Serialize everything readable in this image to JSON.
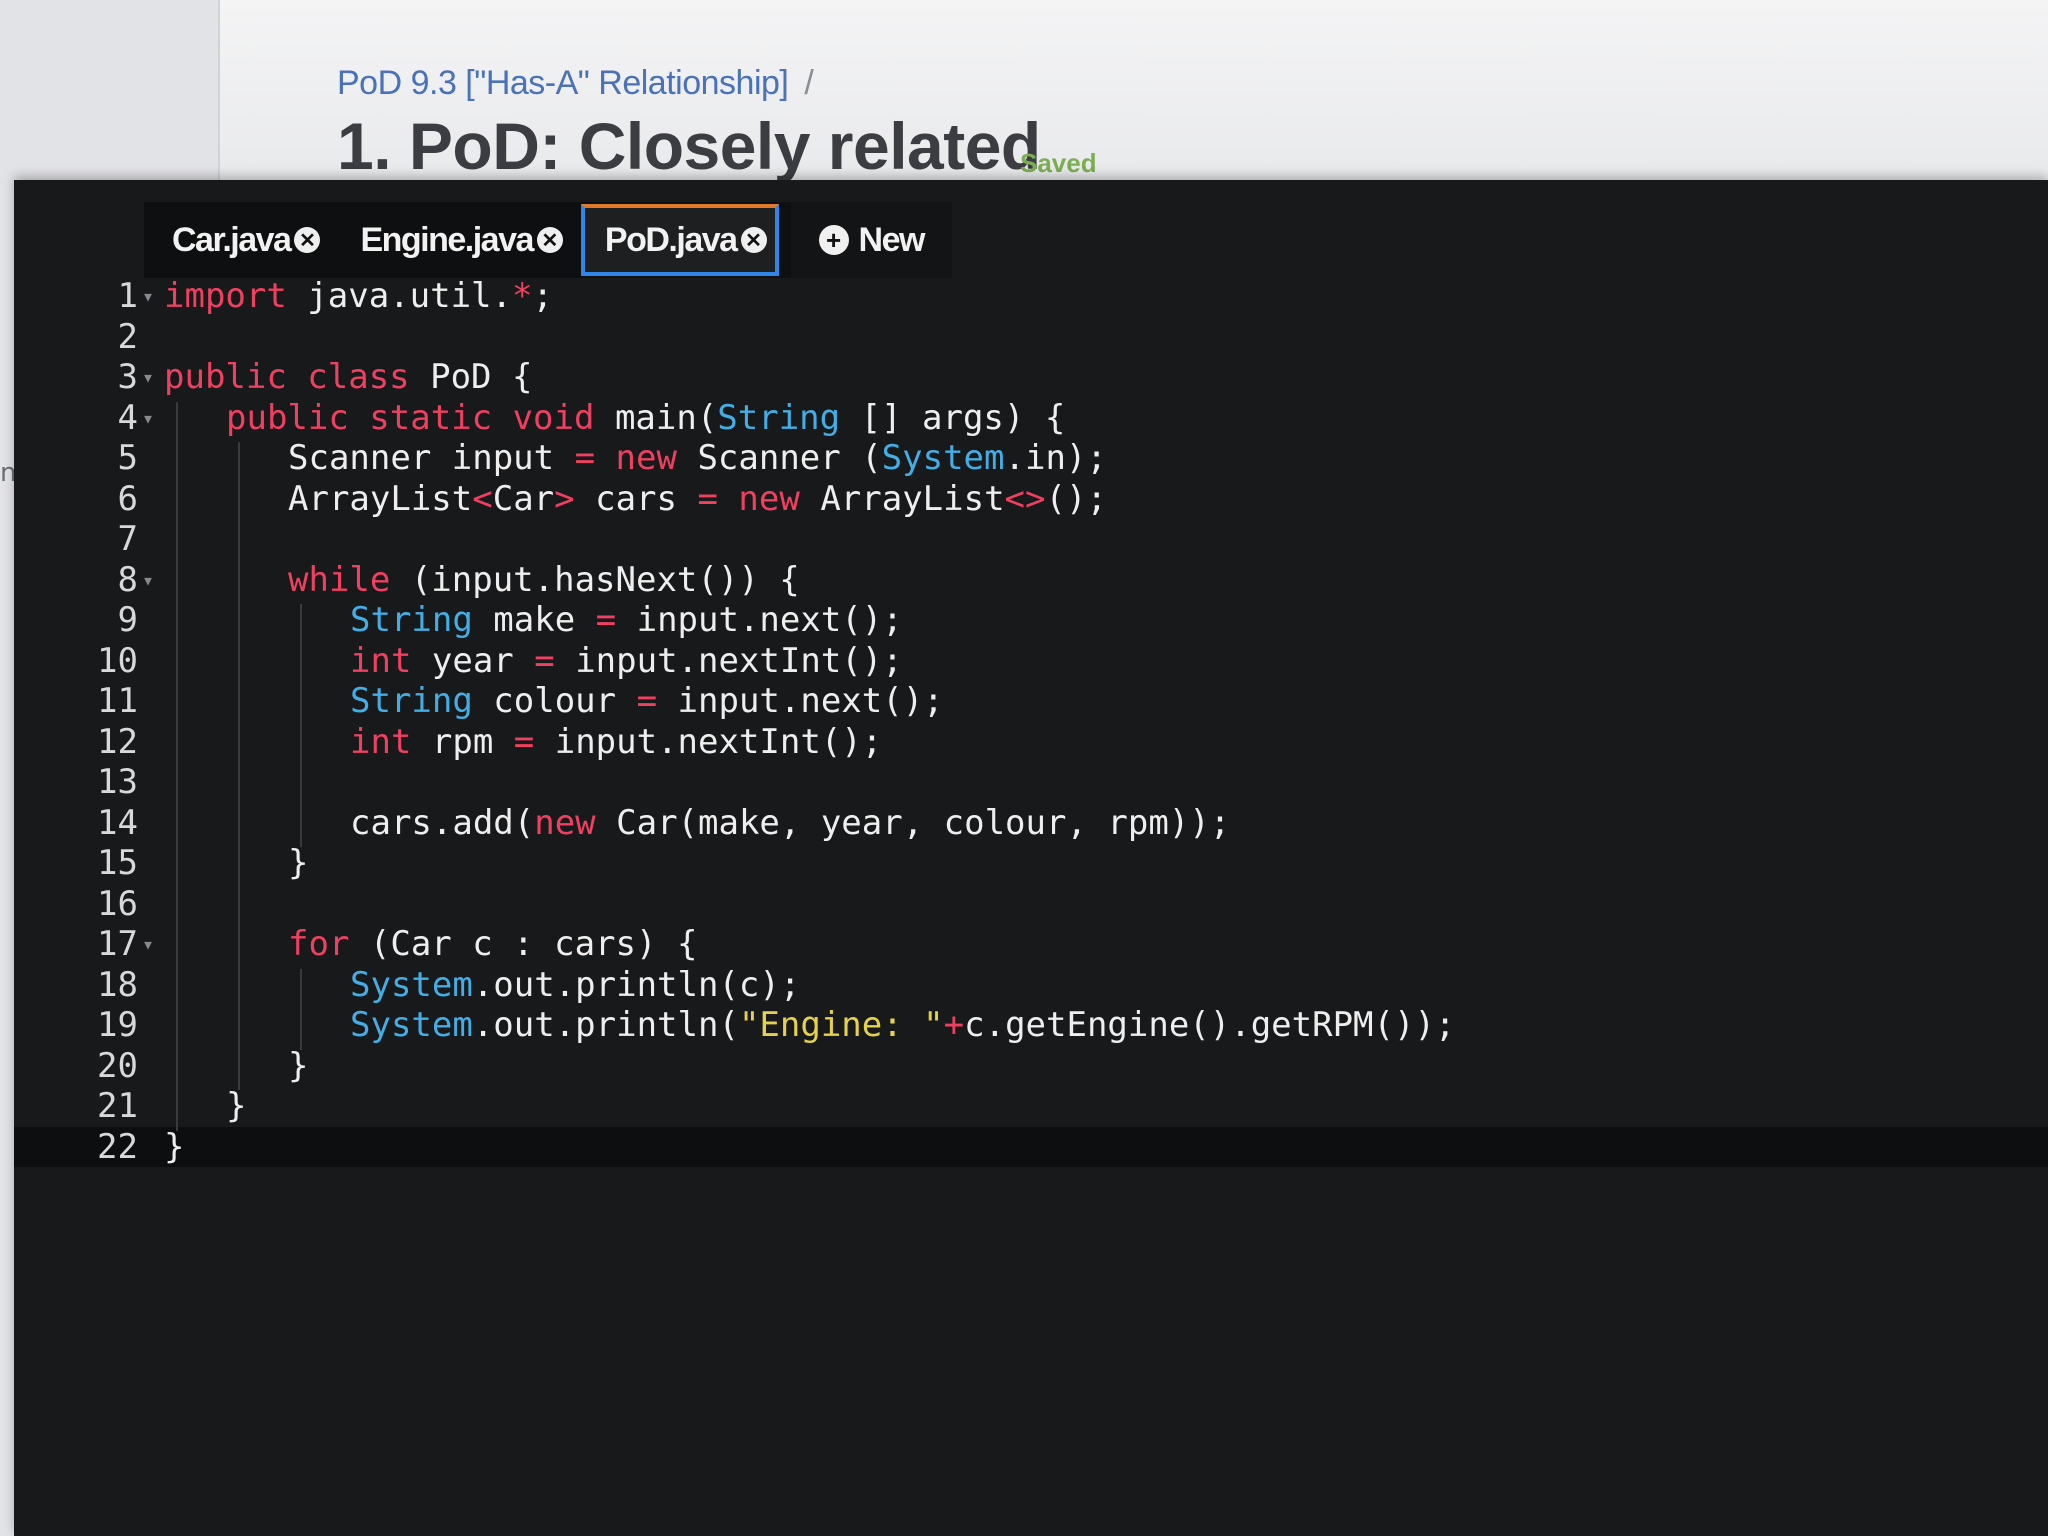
{
  "breadcrumb": {
    "course": "PoD 9.3 [\"Has-A\" Relationship]",
    "separator": "/"
  },
  "page": {
    "title": "1. PoD: Closely related",
    "status": "Saved"
  },
  "side_panel": {
    "label_fragment": "nt"
  },
  "tabs": [
    {
      "label": "Car.java",
      "active": false
    },
    {
      "label": "Engine.java",
      "active": false
    },
    {
      "label": "PoD.java",
      "active": true
    }
  ],
  "new_tab": {
    "label": "New"
  },
  "icons": {
    "close": "close-circle-icon",
    "new": "plus-circle-icon",
    "fold": "fold-arrow-icon"
  },
  "colors": {
    "keyword": "#f0405f",
    "type": "#43aee6",
    "string": "#e6d24a",
    "tab_active_border": "#2f86e8",
    "saved": "#7cae52"
  },
  "editor": {
    "current_line": 22,
    "lines": [
      {
        "n": "1",
        "fold": true,
        "indent": 0,
        "tokens": [
          [
            "k",
            "import"
          ],
          [
            "p",
            " java.util."
          ],
          [
            "k",
            "*"
          ],
          [
            "p",
            ";"
          ]
        ]
      },
      {
        "n": "2",
        "fold": false,
        "indent": 0,
        "tokens": []
      },
      {
        "n": "3",
        "fold": true,
        "indent": 0,
        "tokens": [
          [
            "k",
            "public class"
          ],
          [
            "p",
            " PoD {"
          ]
        ]
      },
      {
        "n": "4",
        "fold": true,
        "indent": 1,
        "tokens": [
          [
            "k",
            "public static void"
          ],
          [
            "p",
            " main("
          ],
          [
            "t",
            "String"
          ],
          [
            "p",
            " [] args) {"
          ]
        ]
      },
      {
        "n": "5",
        "fold": false,
        "indent": 2,
        "tokens": [
          [
            "p",
            "Scanner input "
          ],
          [
            "k",
            "="
          ],
          [
            "p",
            " "
          ],
          [
            "k",
            "new"
          ],
          [
            "p",
            " Scanner ("
          ],
          [
            "t",
            "System"
          ],
          [
            "p",
            ".in);"
          ]
        ]
      },
      {
        "n": "6",
        "fold": false,
        "indent": 2,
        "tokens": [
          [
            "p",
            "ArrayList"
          ],
          [
            "k",
            "<"
          ],
          [
            "p",
            "Car"
          ],
          [
            "k",
            ">"
          ],
          [
            "p",
            " cars "
          ],
          [
            "k",
            "="
          ],
          [
            "p",
            " "
          ],
          [
            "k",
            "new"
          ],
          [
            "p",
            " ArrayList"
          ],
          [
            "k",
            "<>"
          ],
          [
            "p",
            "();"
          ]
        ]
      },
      {
        "n": "7",
        "fold": false,
        "indent": 2,
        "tokens": []
      },
      {
        "n": "8",
        "fold": true,
        "indent": 2,
        "tokens": [
          [
            "k",
            "while"
          ],
          [
            "p",
            " (input.hasNext()) {"
          ]
        ]
      },
      {
        "n": "9",
        "fold": false,
        "indent": 3,
        "tokens": [
          [
            "t",
            "String"
          ],
          [
            "p",
            " make "
          ],
          [
            "k",
            "="
          ],
          [
            "p",
            " input.next();"
          ]
        ]
      },
      {
        "n": "10",
        "fold": false,
        "indent": 3,
        "tokens": [
          [
            "k",
            "int"
          ],
          [
            "p",
            " year "
          ],
          [
            "k",
            "="
          ],
          [
            "p",
            " input.nextInt();"
          ]
        ]
      },
      {
        "n": "11",
        "fold": false,
        "indent": 3,
        "tokens": [
          [
            "t",
            "String"
          ],
          [
            "p",
            " colour "
          ],
          [
            "k",
            "="
          ],
          [
            "p",
            " input.next();"
          ]
        ]
      },
      {
        "n": "12",
        "fold": false,
        "indent": 3,
        "tokens": [
          [
            "k",
            "int"
          ],
          [
            "p",
            " rpm "
          ],
          [
            "k",
            "="
          ],
          [
            "p",
            " input.nextInt();"
          ]
        ]
      },
      {
        "n": "13",
        "fold": false,
        "indent": 3,
        "tokens": []
      },
      {
        "n": "14",
        "fold": false,
        "indent": 3,
        "tokens": [
          [
            "p",
            "cars.add("
          ],
          [
            "k",
            "new"
          ],
          [
            "p",
            " Car(make, year, colour, rpm));"
          ]
        ]
      },
      {
        "n": "15",
        "fold": false,
        "indent": 2,
        "tokens": [
          [
            "p",
            "}"
          ]
        ]
      },
      {
        "n": "16",
        "fold": false,
        "indent": 2,
        "tokens": []
      },
      {
        "n": "17",
        "fold": true,
        "indent": 2,
        "tokens": [
          [
            "k",
            "for"
          ],
          [
            "p",
            " (Car c : cars) {"
          ]
        ]
      },
      {
        "n": "18",
        "fold": false,
        "indent": 3,
        "tokens": [
          [
            "t",
            "System"
          ],
          [
            "p",
            ".out.println(c);"
          ]
        ]
      },
      {
        "n": "19",
        "fold": false,
        "indent": 3,
        "tokens": [
          [
            "t",
            "System"
          ],
          [
            "p",
            ".out.println("
          ],
          [
            "s",
            "\"Engine: \""
          ],
          [
            "k",
            "+"
          ],
          [
            "p",
            "c.getEngine().getRPM());"
          ]
        ]
      },
      {
        "n": "20",
        "fold": false,
        "indent": 2,
        "tokens": [
          [
            "p",
            "}"
          ]
        ]
      },
      {
        "n": "21",
        "fold": false,
        "indent": 1,
        "tokens": [
          [
            "p",
            "}"
          ]
        ]
      },
      {
        "n": "22",
        "fold": false,
        "indent": 0,
        "tokens": [
          [
            "p",
            "}"
          ]
        ]
      }
    ]
  }
}
